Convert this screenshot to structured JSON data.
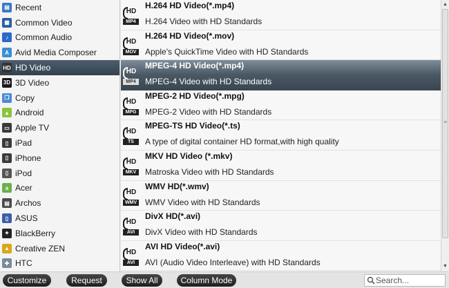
{
  "categories": [
    {
      "label": "Recent",
      "icon": "recent-icon",
      "color": "#3a78c8",
      "glyph": "▤"
    },
    {
      "label": "Common Video",
      "icon": "common-video-icon",
      "color": "#2b5aa5",
      "glyph": "▦"
    },
    {
      "label": "Common Audio",
      "icon": "common-audio-icon",
      "color": "#2b6ac8",
      "glyph": "♪"
    },
    {
      "label": "Avid Media Composer",
      "icon": "avid-icon",
      "color": "#3b8fd4",
      "glyph": "A"
    },
    {
      "label": "HD Video",
      "icon": "hd-video-icon",
      "color": "#333333",
      "glyph": "HD",
      "selected": true
    },
    {
      "label": "3D Video",
      "icon": "3d-video-icon",
      "color": "#1a1a1a",
      "glyph": "3D"
    },
    {
      "label": "Copy",
      "icon": "copy-icon",
      "color": "#4a8ad0",
      "glyph": "❐"
    },
    {
      "label": "Android",
      "icon": "android-icon",
      "color": "#8ac43f",
      "glyph": "▲"
    },
    {
      "label": "Apple TV",
      "icon": "apple-tv-icon",
      "color": "#3a3a3a",
      "glyph": "▭"
    },
    {
      "label": "iPad",
      "icon": "ipad-icon",
      "color": "#3a3a3a",
      "glyph": "▯"
    },
    {
      "label": "iPhone",
      "icon": "iphone-icon",
      "color": "#3a3a3a",
      "glyph": "▯"
    },
    {
      "label": "iPod",
      "icon": "ipod-icon",
      "color": "#555555",
      "glyph": "▯"
    },
    {
      "label": "Acer",
      "icon": "acer-icon",
      "color": "#6ab04c",
      "glyph": "a"
    },
    {
      "label": "Archos",
      "icon": "archos-icon",
      "color": "#4a4a4a",
      "glyph": "▤"
    },
    {
      "label": "ASUS",
      "icon": "asus-icon",
      "color": "#3a5fa8",
      "glyph": "▯"
    },
    {
      "label": "BlackBerry",
      "icon": "blackberry-icon",
      "color": "#222222",
      "glyph": "✦"
    },
    {
      "label": "Creative ZEN",
      "icon": "creative-zen-icon",
      "color": "#d8a81a",
      "glyph": "▲"
    },
    {
      "label": "HTC",
      "icon": "htc-icon",
      "color": "#7a8a9a",
      "glyph": "✚"
    }
  ],
  "formats": [
    {
      "name": "H.264 HD Video(*.mp4)",
      "desc": "H.264 Video with HD Standards",
      "tag": "MP4",
      "icon": "hd-mp4-icon"
    },
    {
      "name": "H.264 HD Video(*.mov)",
      "desc": "Apple's QuickTime Video with HD Standards",
      "tag": "MOV",
      "icon": "hd-mov-icon"
    },
    {
      "name": "MPEG-4 HD Video(*.mp4)",
      "desc": "MPEG-4 Video with HD Standards",
      "tag": "MP4",
      "icon": "hd-mp4-icon",
      "selected": true
    },
    {
      "name": "MPEG-2 HD Video(*.mpg)",
      "desc": "MPEG-2 Video with HD Standards",
      "tag": "MPG",
      "icon": "hd-mpg-icon"
    },
    {
      "name": "MPEG-TS HD Video(*.ts)",
      "desc": "A type of digital container HD format,with high quality",
      "tag": "TS",
      "icon": "hd-ts-icon"
    },
    {
      "name": "MKV HD Video (*.mkv)",
      "desc": "Matroska Video with HD Standards",
      "tag": "MKV",
      "icon": "hd-mkv-icon"
    },
    {
      "name": "WMV HD(*.wmv)",
      "desc": "WMV Video with HD Standards",
      "tag": "WMV",
      "icon": "hd-wmv-icon"
    },
    {
      "name": "DivX HD(*.avi)",
      "desc": "DivX Video with HD Standards",
      "tag": "AVI",
      "icon": "hd-avi-icon"
    },
    {
      "name": "AVI HD Video(*.avi)",
      "desc": "AVI (Audio Video Interleave) with HD Standards",
      "tag": "AVI",
      "icon": "hd-avi-icon"
    }
  ],
  "hd_badge": "HD",
  "toolbar": {
    "customize_label": "Customize",
    "request_label": "Request",
    "show_all_label": "Show All",
    "column_mode_label": "Column Mode"
  },
  "search": {
    "placeholder": "Search..."
  },
  "scrollbar": {
    "up_glyph": "▲",
    "down_glyph": "▼",
    "grip_glyph": "≡"
  },
  "colors": {
    "selection": "#3a4751",
    "button": "#2a2a2a"
  }
}
